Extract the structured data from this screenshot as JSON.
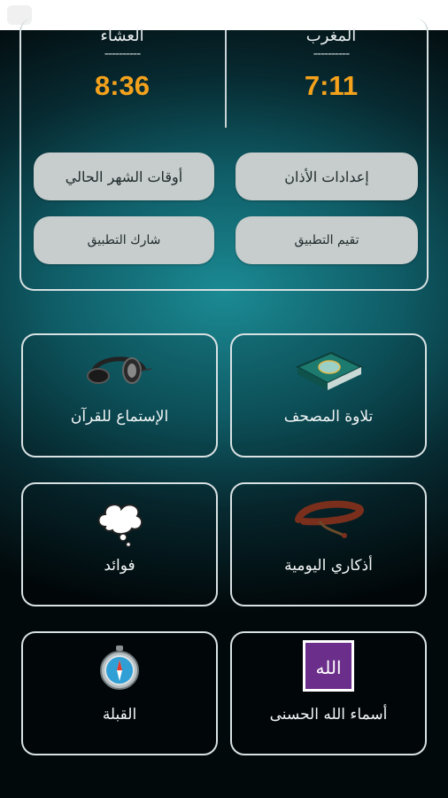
{
  "prayers": [
    {
      "name": "العشاء",
      "dash": "----------",
      "time": "8:36"
    },
    {
      "name": "المغرب",
      "dash": "----------",
      "time": "7:11"
    }
  ],
  "actions": {
    "month_times": "أوقات الشهر الحالي",
    "adhan_settings": "إعدادات الأذان",
    "share_app": "شارك التطبيق",
    "rate_app": "تقيم التطبيق"
  },
  "tiles": {
    "listen_quran": {
      "label": "الإستماع للقرآن",
      "icon": "headphones-icon"
    },
    "mushaf": {
      "label": "تلاوة المصحف",
      "icon": "quran-book-icon"
    },
    "benefits": {
      "label": "فوائد",
      "icon": "thought-bubble-icon"
    },
    "azkar": {
      "label": "أذكاري اليومية",
      "icon": "prayer-beads-icon"
    },
    "qibla": {
      "label": "القبلة",
      "icon": "compass-icon"
    },
    "asma": {
      "label": "أسماء الله الحسنى",
      "icon": "allah-calligraphy-icon",
      "icon_text": "الله"
    }
  },
  "colors": {
    "accent_time": "#f4a21c",
    "button_bg": "#c7cccc",
    "allah_tile_bg": "#6b2e8a"
  }
}
